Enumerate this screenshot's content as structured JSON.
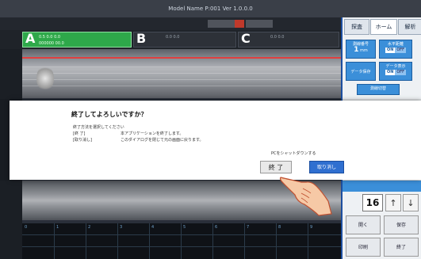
{
  "window": {
    "title": "Model Name  P:001  Ver 1.0.0.0"
  },
  "topstrip": {
    "btn1": "",
    "btn2": "",
    "btn3": ""
  },
  "channels": {
    "a": {
      "letter": "A",
      "line1": "0.5  0.0  0.0",
      "line2": "000000  00.0"
    },
    "b": {
      "letter": "B",
      "line1": "0.0  0.0",
      "line2": ""
    },
    "c": {
      "letter": "C",
      "line1": "0.0  0.0",
      "line2": ""
    }
  },
  "right_panel": {
    "tabs": [
      "探査",
      "ホーム",
      "解析"
    ],
    "btn_a": {
      "title": "測線番号",
      "value": "1",
      "unit": "mm"
    },
    "btn_b": {
      "title": "水平距離",
      "on": "ON",
      "off": "OFF"
    },
    "btn_c": {
      "title": "データ保存"
    },
    "btn_d": {
      "title": "データ表示",
      "on": "ON",
      "off": "OFF"
    },
    "btn_e": {
      "title": "測線切替"
    },
    "number": "16",
    "up": "↑",
    "down": "↓",
    "tool1": "開く",
    "tool2": "保存",
    "tool3": "印刷",
    "tool4": "終了"
  },
  "grid": {
    "labels": [
      "0",
      "1",
      "2",
      "3",
      "4",
      "5",
      "6",
      "7",
      "8",
      "9"
    ]
  },
  "dialog": {
    "title": "終了してよろしいですか？",
    "line1": "終了方法を選択してください",
    "line2_key": "[終 了]",
    "line2_val": "本アプリケーションを終了します。",
    "line3_key": "[取り消し]",
    "line3_val": "このダイアログを閉じて元の画面に戻ります。",
    "hint": "PCをシャットダウンする",
    "end_button": "終 了",
    "cancel_button": "取り消し"
  },
  "colors": {
    "channel_a": "#2ea84a",
    "accent_blue": "#3b8fd9",
    "cancel_blue": "#2f6fd0",
    "scan_redline": "#e04040"
  },
  "icons": {
    "hand": "pointing-hand-icon"
  }
}
